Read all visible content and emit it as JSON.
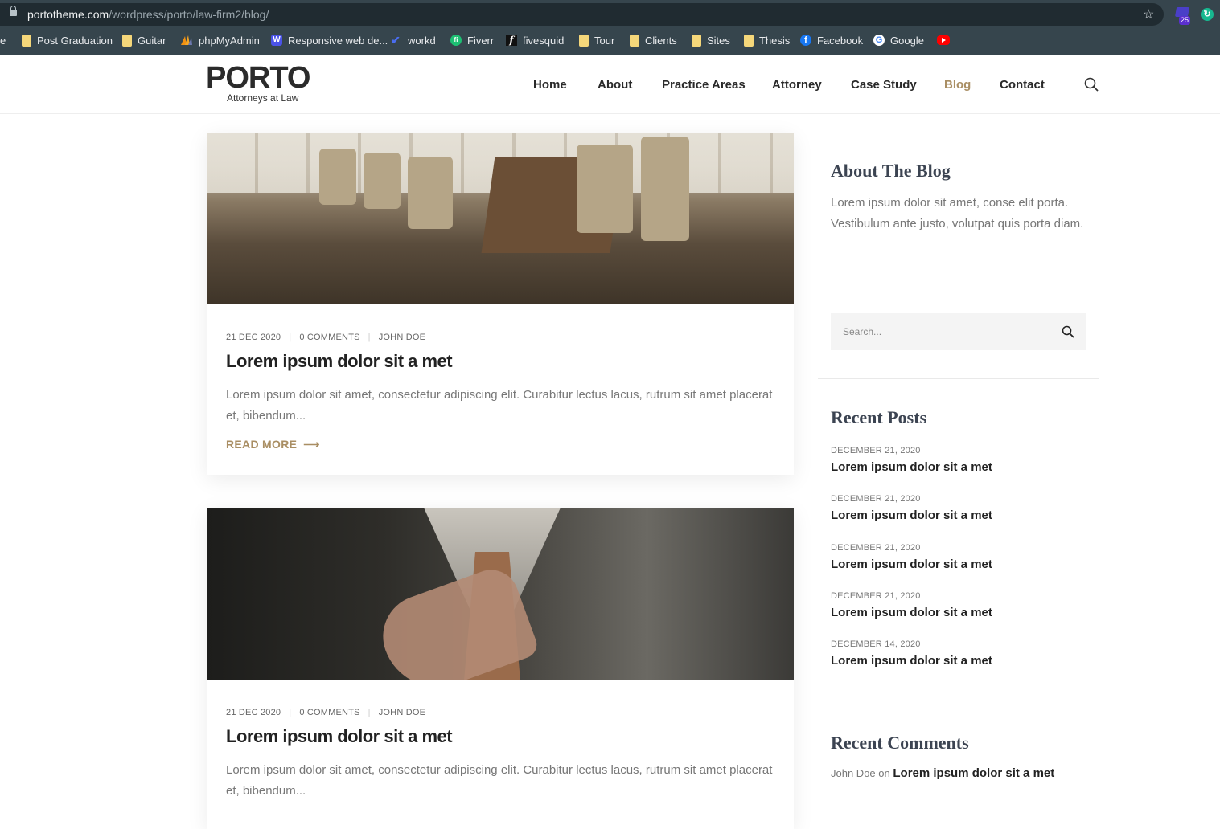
{
  "browser": {
    "url_host": "portotheme.com",
    "url_path": "/wordpress/porto/law-firm2/blog/",
    "extension_badge": "25",
    "bookmarks": [
      {
        "label": "e",
        "icon": "none"
      },
      {
        "label": "Post Graduation",
        "icon": "folder-icon"
      },
      {
        "label": "Guitar",
        "icon": "folder-icon"
      },
      {
        "label": "phpMyAdmin",
        "icon": "phpmyadmin-icon"
      },
      {
        "label": "Responsive web de...",
        "icon": "w-icon"
      },
      {
        "label": "workd",
        "icon": "check-icon"
      },
      {
        "label": "Fiverr",
        "icon": "fiverr-icon"
      },
      {
        "label": "fivesquid",
        "icon": "fivesquid-icon"
      },
      {
        "label": "Tour",
        "icon": "folder-icon"
      },
      {
        "label": "Clients",
        "icon": "folder-icon"
      },
      {
        "label": "Sites",
        "icon": "folder-icon"
      },
      {
        "label": "Thesis",
        "icon": "folder-icon"
      },
      {
        "label": "Facebook",
        "icon": "facebook-icon"
      },
      {
        "label": "Google",
        "icon": "google-icon"
      },
      {
        "label": "",
        "icon": "youtube-icon"
      }
    ]
  },
  "header": {
    "logo_main": "PORTO",
    "logo_sub": "Attorneys at Law",
    "nav": [
      "Home",
      "About",
      "Practice Areas",
      "Attorney",
      "Case Study",
      "Blog",
      "Contact"
    ],
    "active_nav": "Blog"
  },
  "posts": [
    {
      "date": "21 DEC 2020",
      "comments": "0 COMMENTS",
      "author": "JOHN DOE",
      "title": "Lorem ipsum dolor sit a met",
      "excerpt": "Lorem ipsum dolor sit amet, consectetur adipiscing elit. Curabitur lectus lacus, rutrum sit amet placerat et, bibendum...",
      "read_more": "READ MORE"
    },
    {
      "date": "21 DEC 2020",
      "comments": "0 COMMENTS",
      "author": "JOHN DOE",
      "title": "Lorem ipsum dolor sit a met",
      "excerpt": "Lorem ipsum dolor sit amet, consectetur adipiscing elit. Curabitur lectus lacus, rutrum sit amet placerat et, bibendum..."
    }
  ],
  "sidebar": {
    "about_title": "About The Blog",
    "about_text": "Lorem ipsum dolor sit amet, conse elit porta. Vestibulum ante justo, volutpat quis porta diam.",
    "search_placeholder": "Search...",
    "recent_posts_title": "Recent Posts",
    "recent_posts": [
      {
        "date": "DECEMBER 21, 2020",
        "title": "Lorem ipsum dolor sit a met"
      },
      {
        "date": "DECEMBER 21, 2020",
        "title": "Lorem ipsum dolor sit a met"
      },
      {
        "date": "DECEMBER 21, 2020",
        "title": "Lorem ipsum dolor sit a met"
      },
      {
        "date": "DECEMBER 21, 2020",
        "title": "Lorem ipsum dolor sit a met"
      },
      {
        "date": "DECEMBER 14, 2020",
        "title": "Lorem ipsum dolor sit a met"
      }
    ],
    "recent_comments_title": "Recent Comments",
    "recent_comment": {
      "author": "John Doe",
      "on": "on",
      "post": "Lorem ipsum dolor sit a met"
    }
  },
  "colors": {
    "accent": "#a98e63",
    "chrome": "#36454d",
    "heading": "#3c4452"
  }
}
